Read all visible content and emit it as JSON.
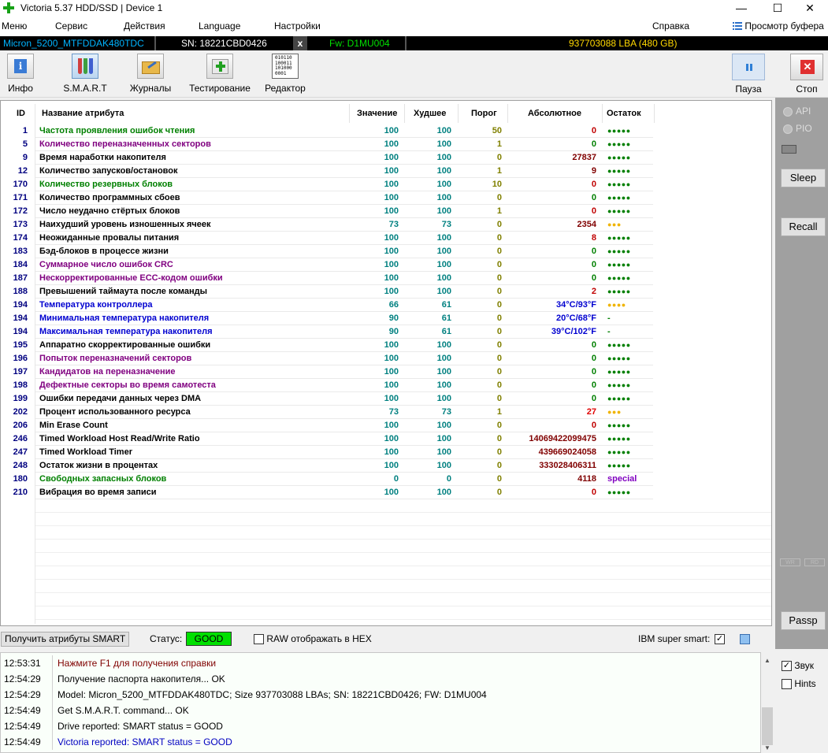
{
  "window": {
    "title": "Victoria 5.37 HDD/SSD | Device 1",
    "minimize": "—",
    "maximize": "☐",
    "close": "✕"
  },
  "menu": {
    "items": [
      "Меню",
      "Сервис",
      "Действия",
      "Language",
      "Настройки"
    ],
    "help": "Справка",
    "buffer": "Просмотр буфера"
  },
  "device": {
    "model": "Micron_5200_MTFDDAK480TDC",
    "serial": "SN: 18221CBD0426",
    "x_label": "x",
    "firmware": "Fw: D1MU004",
    "capacity": "937703088 LBA (480 GB)",
    "colors": {
      "model": "#00b4ff",
      "serial": "#ffffff",
      "firmware": "#00e000",
      "capacity": "#ffd800"
    }
  },
  "toolbar": {
    "info": "Инфо",
    "smart": "S.M.A.R.T",
    "logs": "Журналы",
    "test": "Тестирование",
    "editor": "Редактор",
    "pause": "Пауза",
    "stop": "Стоп",
    "editor_icon_text": [
      "010110",
      "100011",
      "101000",
      "0001"
    ]
  },
  "table": {
    "headers": {
      "id": "ID",
      "name": "Название атрибута",
      "value": "Значение",
      "worst": "Худшее",
      "threshold": "Порог",
      "raw": "Абсолютное",
      "health": "Остаток"
    },
    "rows": [
      {
        "id": "1",
        "name": "Частота проявления ошибок чтения",
        "value": "100",
        "worst": "100",
        "threshold": "50",
        "raw": "0",
        "health": "●●●●●",
        "name_color": "#008000",
        "raw_color": "#c00000",
        "health_color": "#008000"
      },
      {
        "id": "5",
        "name": "Количество переназначенных секторов",
        "value": "100",
        "worst": "100",
        "threshold": "1",
        "raw": "0",
        "health": "●●●●●",
        "name_color": "#800080",
        "raw_color": "#008000",
        "health_color": "#008000"
      },
      {
        "id": "9",
        "name": "Время наработки накопителя",
        "value": "100",
        "worst": "100",
        "threshold": "0",
        "raw": "27837",
        "health": "●●●●●",
        "name_color": "#000000",
        "raw_color": "#800000",
        "health_color": "#008000"
      },
      {
        "id": "12",
        "name": "Количество запусков/остановок",
        "value": "100",
        "worst": "100",
        "threshold": "1",
        "raw": "9",
        "health": "●●●●●",
        "name_color": "#000000",
        "raw_color": "#800000",
        "health_color": "#008000"
      },
      {
        "id": "170",
        "name": "Количество резервных блоков",
        "value": "100",
        "worst": "100",
        "threshold": "10",
        "raw": "0",
        "health": "●●●●●",
        "name_color": "#008000",
        "raw_color": "#c00000",
        "health_color": "#008000"
      },
      {
        "id": "171",
        "name": "Количество программных сбоев",
        "value": "100",
        "worst": "100",
        "threshold": "0",
        "raw": "0",
        "health": "●●●●●",
        "name_color": "#000000",
        "raw_color": "#008000",
        "health_color": "#008000"
      },
      {
        "id": "172",
        "name": "Число неудачно стёртых блоков",
        "value": "100",
        "worst": "100",
        "threshold": "1",
        "raw": "0",
        "health": "●●●●●",
        "name_color": "#000000",
        "raw_color": "#c00000",
        "health_color": "#008000"
      },
      {
        "id": "173",
        "name": "Наихудший уровень изношенных ячеек",
        "value": "73",
        "worst": "73",
        "threshold": "0",
        "raw": "2354",
        "health": "●●●",
        "name_color": "#000000",
        "raw_color": "#800000",
        "health_color": "#f0b400"
      },
      {
        "id": "174",
        "name": "Неожиданные провалы питания",
        "value": "100",
        "worst": "100",
        "threshold": "0",
        "raw": "8",
        "health": "●●●●●",
        "name_color": "#000000",
        "raw_color": "#c00000",
        "health_color": "#008000"
      },
      {
        "id": "183",
        "name": "Бэд-блоков в процессе жизни",
        "value": "100",
        "worst": "100",
        "threshold": "0",
        "raw": "0",
        "health": "●●●●●",
        "name_color": "#000000",
        "raw_color": "#008000",
        "health_color": "#008000"
      },
      {
        "id": "184",
        "name": "Суммарное число ошибок CRC",
        "value": "100",
        "worst": "100",
        "threshold": "0",
        "raw": "0",
        "health": "●●●●●",
        "name_color": "#800080",
        "raw_color": "#008000",
        "health_color": "#008000"
      },
      {
        "id": "187",
        "name": "Нескорректированные ECC-кодом ошибки",
        "value": "100",
        "worst": "100",
        "threshold": "0",
        "raw": "0",
        "health": "●●●●●",
        "name_color": "#800080",
        "raw_color": "#008000",
        "health_color": "#008000"
      },
      {
        "id": "188",
        "name": "Превышений таймаута после команды",
        "value": "100",
        "worst": "100",
        "threshold": "0",
        "raw": "2",
        "health": "●●●●●",
        "name_color": "#000000",
        "raw_color": "#c00000",
        "health_color": "#008000"
      },
      {
        "id": "194",
        "name": "Температура контроллера",
        "value": "66",
        "worst": "61",
        "threshold": "0",
        "raw": "34°C/93°F",
        "health": "●●●●",
        "name_color": "#0000d0",
        "raw_color": "#0000d0",
        "health_color": "#f0b400"
      },
      {
        "id": "194",
        "name": "Минимальная температура накопителя",
        "value": "90",
        "worst": "61",
        "threshold": "0",
        "raw": "20°C/68°F",
        "health": "-",
        "name_color": "#0000d0",
        "raw_color": "#0000d0",
        "health_color": "#008000"
      },
      {
        "id": "194",
        "name": "Максимальная температура накопителя",
        "value": "90",
        "worst": "61",
        "threshold": "0",
        "raw": "39°C/102°F",
        "health": "-",
        "name_color": "#0000d0",
        "raw_color": "#0000d0",
        "health_color": "#008000"
      },
      {
        "id": "195",
        "name": "Аппаратно скорректированные ошибки",
        "value": "100",
        "worst": "100",
        "threshold": "0",
        "raw": "0",
        "health": "●●●●●",
        "name_color": "#000000",
        "raw_color": "#008000",
        "health_color": "#008000"
      },
      {
        "id": "196",
        "name": "Попыток переназначений секторов",
        "value": "100",
        "worst": "100",
        "threshold": "0",
        "raw": "0",
        "health": "●●●●●",
        "name_color": "#800080",
        "raw_color": "#008000",
        "health_color": "#008000"
      },
      {
        "id": "197",
        "name": "Кандидатов на переназначение",
        "value": "100",
        "worst": "100",
        "threshold": "0",
        "raw": "0",
        "health": "●●●●●",
        "name_color": "#800080",
        "raw_color": "#008000",
        "health_color": "#008000"
      },
      {
        "id": "198",
        "name": "Дефектные секторы во время самотеста",
        "value": "100",
        "worst": "100",
        "threshold": "0",
        "raw": "0",
        "health": "●●●●●",
        "name_color": "#800080",
        "raw_color": "#008000",
        "health_color": "#008000"
      },
      {
        "id": "199",
        "name": "Ошибки передачи данных через DMA",
        "value": "100",
        "worst": "100",
        "threshold": "0",
        "raw": "0",
        "health": "●●●●●",
        "name_color": "#000000",
        "raw_color": "#008000",
        "health_color": "#008000"
      },
      {
        "id": "202",
        "name": "Процент использованного ресурса",
        "value": "73",
        "worst": "73",
        "threshold": "1",
        "raw": "27",
        "health": "●●●",
        "name_color": "#000000",
        "raw_color": "#e00000",
        "health_color": "#f0b400"
      },
      {
        "id": "206",
        "name": "Min Erase Count",
        "value": "100",
        "worst": "100",
        "threshold": "0",
        "raw": "0",
        "health": "●●●●●",
        "name_color": "#000000",
        "raw_color": "#c00000",
        "health_color": "#008000"
      },
      {
        "id": "246",
        "name": "Timed Workload Host Read/Write Ratio",
        "value": "100",
        "worst": "100",
        "threshold": "0",
        "raw": "14069422099475",
        "health": "●●●●●",
        "name_color": "#000000",
        "raw_color": "#800000",
        "health_color": "#008000"
      },
      {
        "id": "247",
        "name": "Timed Workload Timer",
        "value": "100",
        "worst": "100",
        "threshold": "0",
        "raw": "439669024058",
        "health": "●●●●●",
        "name_color": "#000000",
        "raw_color": "#800000",
        "health_color": "#008000"
      },
      {
        "id": "248",
        "name": "Остаток жизни в процентах",
        "value": "100",
        "worst": "100",
        "threshold": "0",
        "raw": "333028406311",
        "health": "●●●●●",
        "name_color": "#000000",
        "raw_color": "#800000",
        "health_color": "#008000"
      },
      {
        "id": "180",
        "name": "Свободных запасных блоков",
        "value": "0",
        "worst": "0",
        "threshold": "0",
        "raw": "4118",
        "health": "special",
        "name_color": "#008000",
        "raw_color": "#800000",
        "health_color": "#8000c0"
      },
      {
        "id": "210",
        "name": "Вибрация во время записи",
        "value": "100",
        "worst": "100",
        "threshold": "0",
        "raw": "0",
        "health": "●●●●●",
        "name_color": "#000000",
        "raw_color": "#c00000",
        "health_color": "#008000"
      }
    ],
    "colors": {
      "id": "#000080",
      "value": "#008080",
      "worst": "#008080",
      "threshold": "#808000"
    }
  },
  "rightpanel": {
    "api": "API",
    "pio": "PIO",
    "sleep": "Sleep",
    "recall": "Recall",
    "passp": "Passp",
    "wr": "WR",
    "rd": "RD"
  },
  "statusbar": {
    "get_smart": "Получить атрибуты SMART",
    "status_label": "Статус:",
    "status_value": "GOOD",
    "raw_hex": "RAW отображать в HEX",
    "ibm": "IBM super smart:",
    "ibm_check": "✓"
  },
  "log": {
    "entries": [
      {
        "time": "12:53:31",
        "text": "Нажмите F1 для получения справки",
        "color": "#800000"
      },
      {
        "time": "12:54:29",
        "text": "Получение паспорта накопителя... OK",
        "color": "#000000"
      },
      {
        "time": "12:54:29",
        "text": "Model: Micron_5200_MTFDDAK480TDC; Size 937703088 LBAs; SN: 18221CBD0426; FW: D1MU004",
        "color": "#000000"
      },
      {
        "time": "12:54:49",
        "text": "Get S.M.A.R.T. command... OK",
        "color": "#000000"
      },
      {
        "time": "12:54:49",
        "text": "Drive reported: SMART status = GOOD",
        "color": "#000000"
      },
      {
        "time": "12:54:49",
        "text": "Victoria reported: SMART status = GOOD",
        "color": "#0000c0"
      }
    ],
    "sound": "Звук",
    "sound_check": "✓",
    "hints": "Hints"
  }
}
